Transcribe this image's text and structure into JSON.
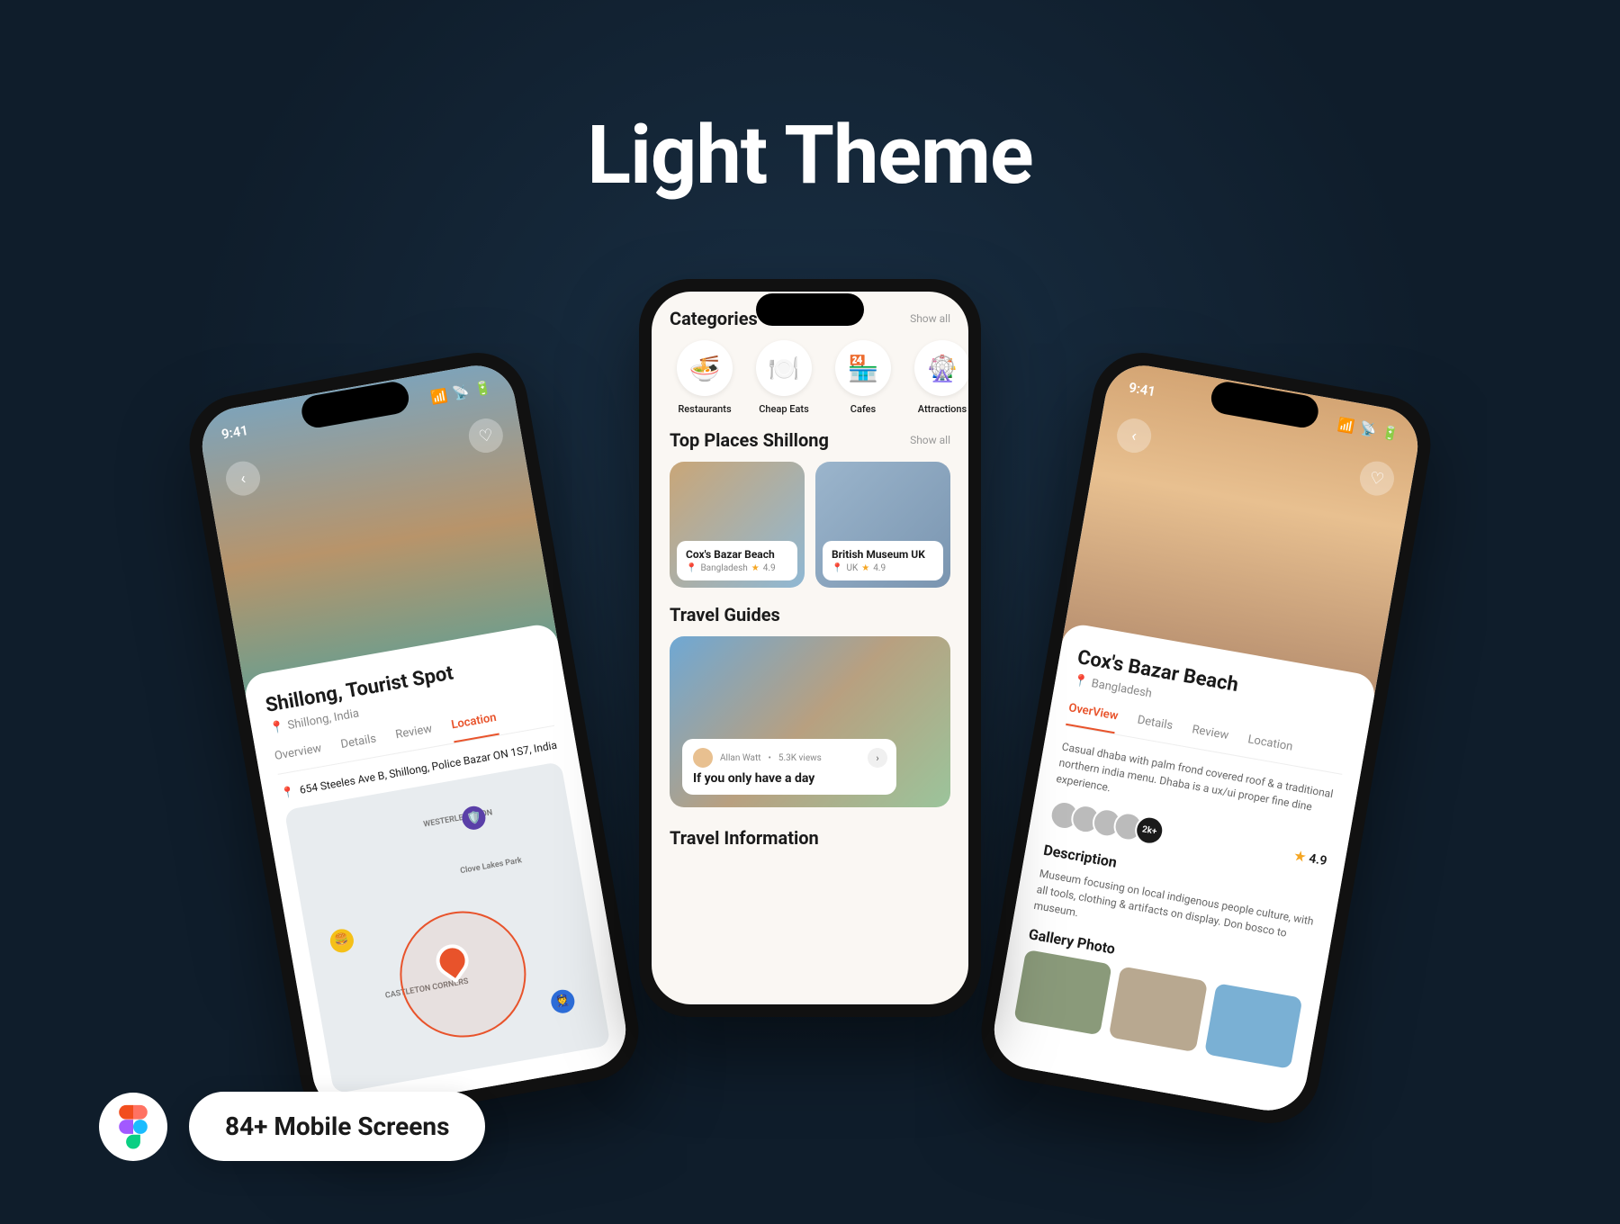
{
  "page_title": "Light Theme",
  "footer_badge": "84+ Mobile Screens",
  "status_time": "9:41",
  "phone_left": {
    "title": "Shillong, Tourist Spot",
    "location": "Shillong, India",
    "tabs": [
      "Overview",
      "Details",
      "Review",
      "Location"
    ],
    "active_tab": "Location",
    "address": "654 Steeles Ave B, Shillong, Police Bazar ON 1S7, India",
    "map_labels": {
      "a": "WESTERLEIGHTON",
      "b": "Clove Lakes Park",
      "c": "CASTLETON CORNERS"
    }
  },
  "phone_center": {
    "sections": {
      "categories": {
        "title": "Categories",
        "link": "Show all"
      },
      "top_places": {
        "title": "Top Places Shillong",
        "link": "Show all"
      },
      "guides": {
        "title": "Travel Guides"
      },
      "info": {
        "title": "Travel Information"
      }
    },
    "categories": [
      {
        "name": "Restaurants",
        "icon": "🍜"
      },
      {
        "name": "Cheap Eats",
        "icon": "🍽️"
      },
      {
        "name": "Cafes",
        "icon": "🏪"
      },
      {
        "name": "Attractions",
        "icon": "🎡"
      }
    ],
    "top_places": [
      {
        "title": "Cox's Bazar Beach",
        "country": "Bangladesh",
        "rating": "4.9"
      },
      {
        "title": "British Museum UK",
        "country": "UK",
        "rating": "4.9"
      }
    ],
    "guide": {
      "author": "Allan Watt",
      "views": "5.3K views",
      "title": "If you only have a day"
    }
  },
  "phone_right": {
    "title": "Cox's Bazar Beach",
    "location": "Bangladesh",
    "tabs": [
      "OverView",
      "Details",
      "Review",
      "Location"
    ],
    "active_tab": "OverView",
    "summary": "Casual dhaba with palm frond covered roof & a traditional northern india menu. Dhaba is a ux/ui proper fine dine experience.",
    "avatar_more": "2k+",
    "rating": "4.9",
    "desc_title": "Description",
    "description": "Museum focusing on local indigenous people culture, with all tools, clothing & artifacts on display. Don bosco to museum.",
    "gallery_title": "Gallery Photo"
  }
}
